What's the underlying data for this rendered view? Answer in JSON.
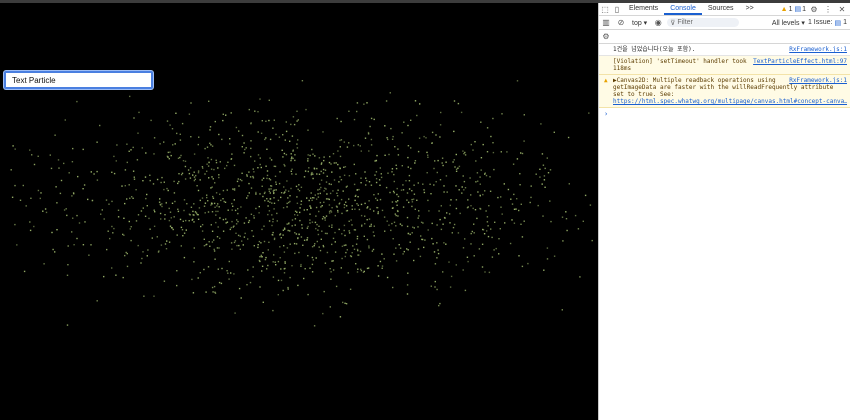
{
  "page": {
    "input_value": "Text Particle",
    "particle_color": "#9ab36a"
  },
  "devtools": {
    "tabs": [
      "Elements",
      "Console",
      "Sources"
    ],
    "active_tab": "Console",
    "more_tabs": ">>",
    "warnings_count": "1",
    "messages_count": "1",
    "context": "top ▾",
    "filter_placeholder": "Filter",
    "levels": "All levels ▾",
    "issues": "1 Issue:",
    "issues_count": "1",
    "messages": [
      {
        "type": "log",
        "text": "1건을 넘었습니다(오늘 포함).",
        "source": "RxFramework.js:1"
      },
      {
        "type": "warning",
        "text": "[Violation] 'setTimeout' handler took 118ms",
        "source": "TextParticleEffect.html:97"
      },
      {
        "type": "warning",
        "text": "▶Canvas2D: Multiple readback operations using getImageData are faster with the willReadFrequently attribute set to true. See:",
        "source": "RxFramework.js:1",
        "link": "https://html.spec.whatwg.org/multipage/canvas.html#concept-canva…"
      }
    ],
    "prompt": "›"
  }
}
